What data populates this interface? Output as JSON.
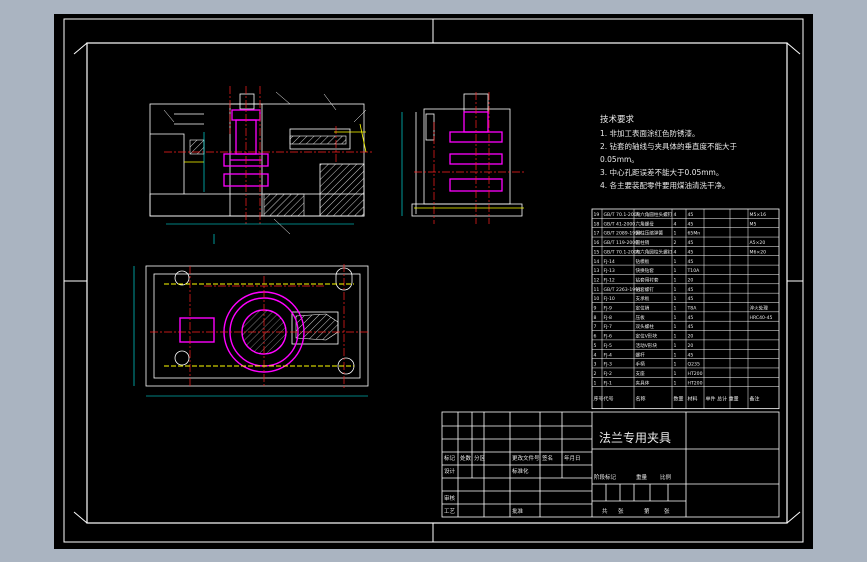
{
  "title_block": {
    "drawing_name": "法兰专用夹具",
    "labels": {
      "mark": "标记",
      "count": "处数",
      "zone": "分区",
      "change_doc": "更改文件号",
      "sign": "签名",
      "date": "年月日",
      "design": "设计",
      "standardize": "标准化",
      "review": "审核",
      "process": "工艺",
      "approve": "批准",
      "stage_mark": "阶段标记",
      "weight": "重量",
      "scale": "比例",
      "total": "共",
      "sheet_no": "张",
      "sheet_of": "第",
      "sheet_unit": "张"
    }
  },
  "tech_req": {
    "heading": "技术要求",
    "lines": [
      "1. 非加工表面涂红色防锈漆。",
      "2. 钻套的轴线与夹具体的垂直度不能大于",
      "0.05mm。",
      "3. 中心孔距误差不能大于0.05mm。",
      "4. 各主要装配零件要用煤油清洗干净。"
    ]
  },
  "bom": {
    "header": [
      "序号",
      "代号",
      "名称",
      "数量",
      "材料",
      "单件 总计 重量",
      "备注"
    ],
    "rows": [
      [
        "19",
        "GB/T 70.1-2000",
        "内六角圆柱头螺钉",
        "4",
        "45",
        "",
        "M5×16"
      ],
      [
        "18",
        "GB/T 41-2000",
        "六角螺母",
        "4",
        "45",
        "",
        "M5"
      ],
      [
        "17",
        "GB/T 2089-1994",
        "圆柱压缩弹簧",
        "1",
        "65Mn",
        "",
        ""
      ],
      [
        "16",
        "GB/T 119-2000",
        "圆柱销",
        "2",
        "45",
        "",
        "A5×20"
      ],
      [
        "15",
        "GB/T 70.1-2000",
        "内六角圆柱头螺钉",
        "4",
        "45",
        "",
        "M6×20"
      ],
      [
        "14",
        "FJ-14",
        "钻模板",
        "1",
        "45",
        "",
        ""
      ],
      [
        "13",
        "FJ-13",
        "快换钻套",
        "1",
        "T10A",
        "",
        ""
      ],
      [
        "12",
        "FJ-12",
        "钻套用衬套",
        "1",
        "20",
        "",
        ""
      ],
      [
        "11",
        "GB/T 2263-1991",
        "钻套螺钉",
        "1",
        "45",
        "",
        ""
      ],
      [
        "10",
        "FJ-10",
        "支承板",
        "1",
        "45",
        "",
        ""
      ],
      [
        "9",
        "FJ-9",
        "定位销",
        "1",
        "T8A",
        "",
        "淬火处理"
      ],
      [
        "8",
        "FJ-8",
        "压板",
        "1",
        "45",
        "",
        "HRC40-45"
      ],
      [
        "7",
        "FJ-7",
        "双头螺柱",
        "1",
        "45",
        "",
        ""
      ],
      [
        "6",
        "FJ-6",
        "定位V形块",
        "1",
        "20",
        "",
        ""
      ],
      [
        "5",
        "FJ-5",
        "活动V形块",
        "1",
        "20",
        "",
        ""
      ],
      [
        "4",
        "FJ-4",
        "螺杆",
        "1",
        "45",
        "",
        ""
      ],
      [
        "3",
        "FJ-3",
        "手柄",
        "1",
        "Q235",
        "",
        ""
      ],
      [
        "2",
        "FJ-2",
        "支座",
        "1",
        "HT200",
        "",
        ""
      ],
      [
        "1",
        "FJ-1",
        "夹具体",
        "1",
        "HT200",
        "",
        ""
      ]
    ]
  },
  "colors": {
    "background": "#000000",
    "frame": "#ffffff",
    "outline": "#ffffff",
    "centerline": "#ff2020",
    "drill_parts": "#ff00ff",
    "hatch": "#ffffff",
    "hidden": "#ffff00",
    "dimension": "#00ffff"
  }
}
